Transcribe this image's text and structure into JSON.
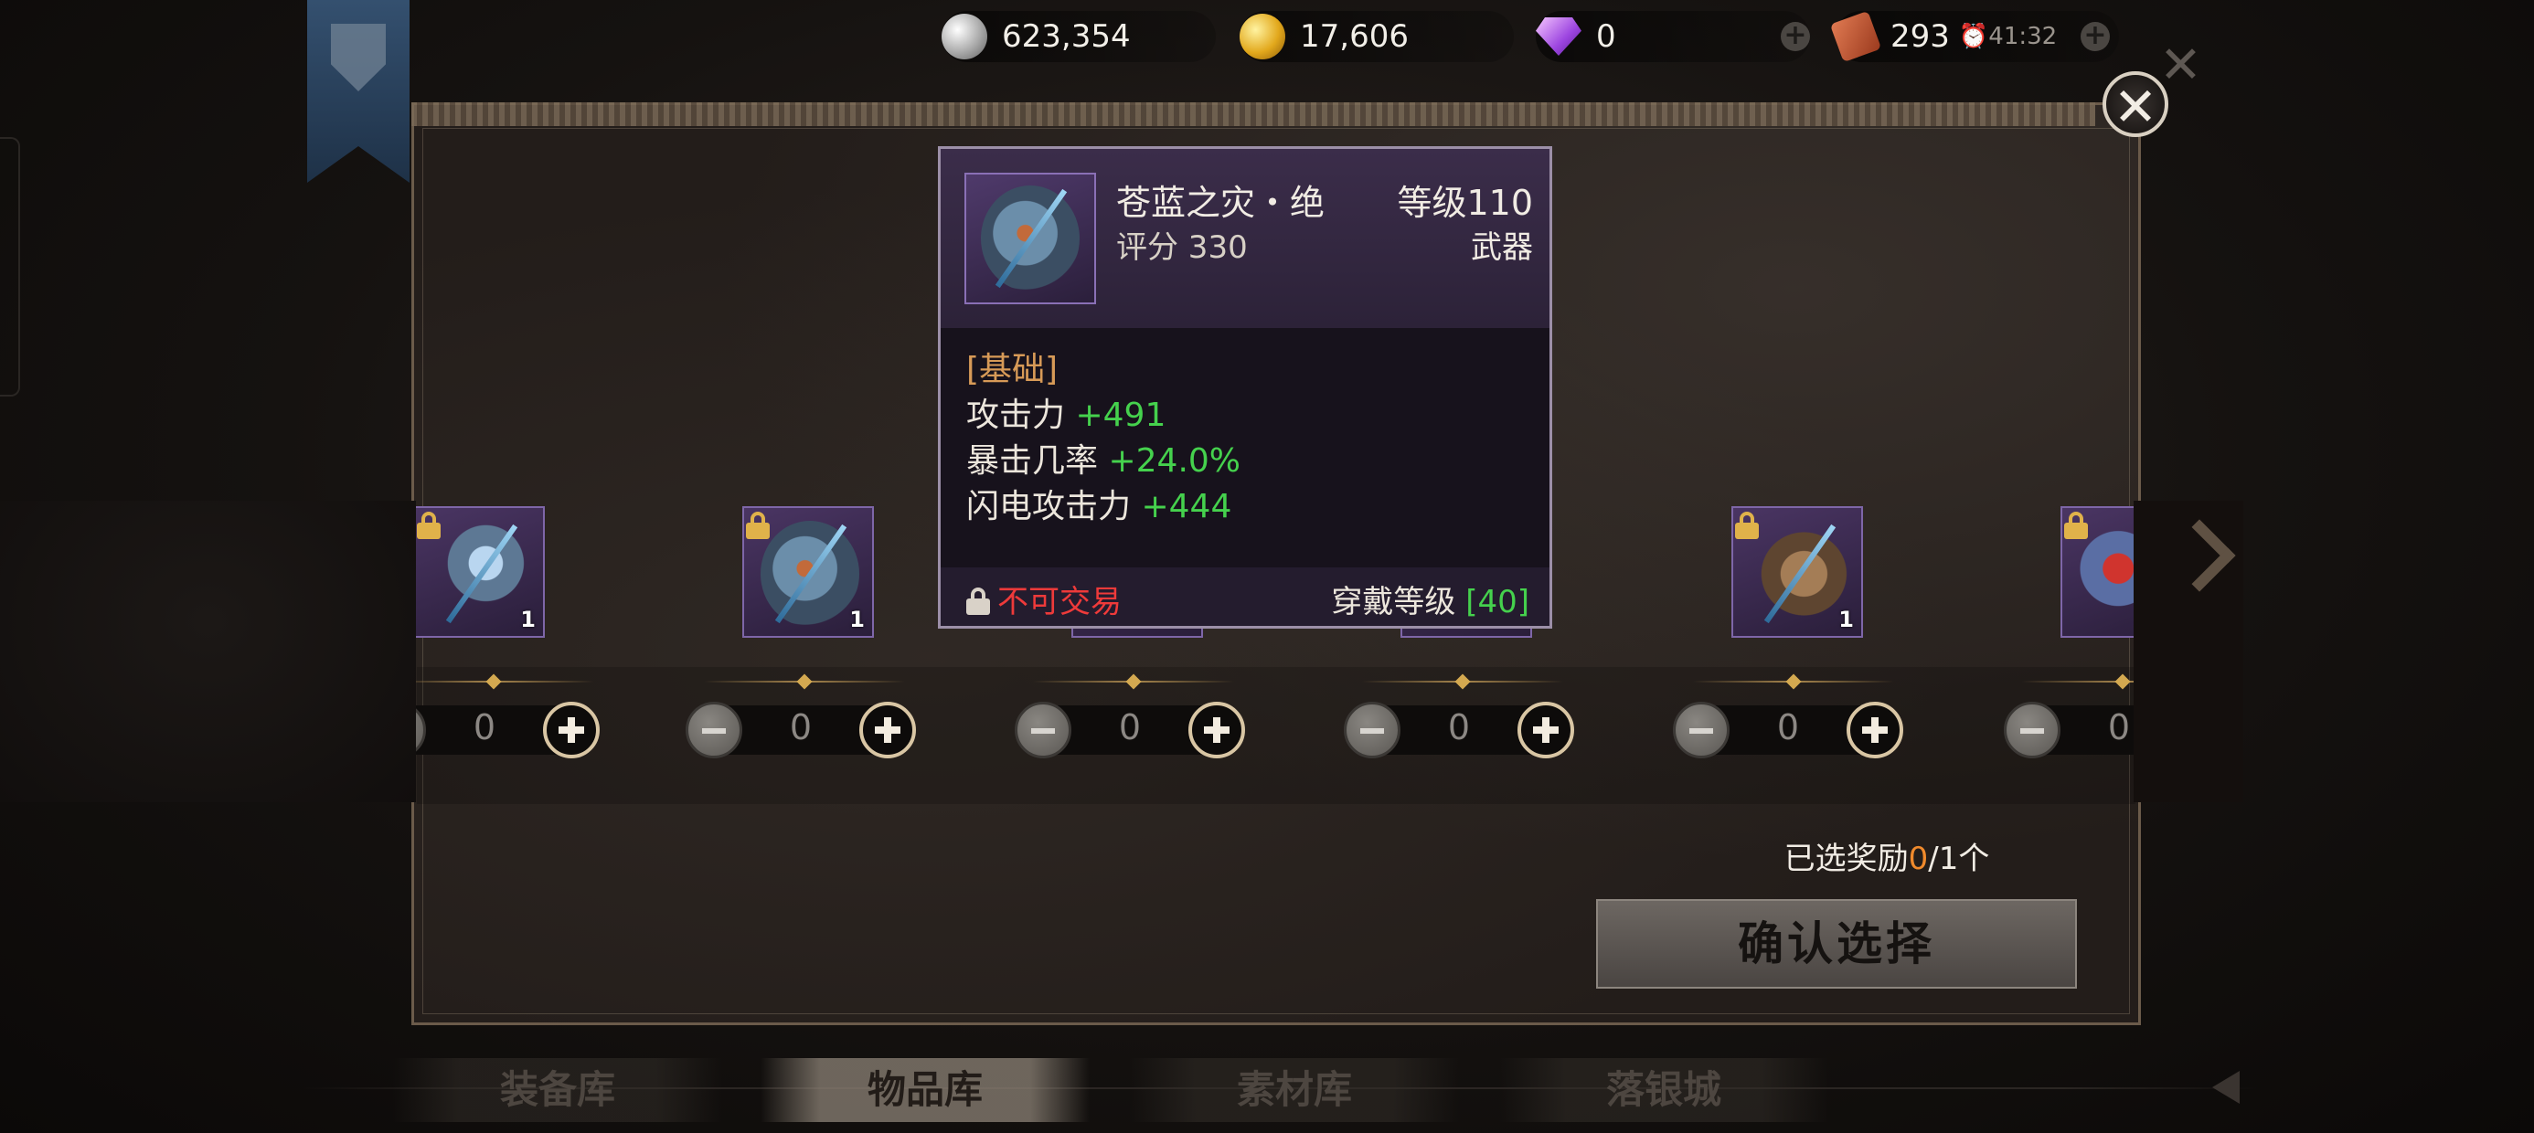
{
  "resources": {
    "silver": {
      "value": "623,354",
      "icon": "silver-coin-icon"
    },
    "gold": {
      "value": "17,606",
      "icon": "gold-coin-icon"
    },
    "gems": {
      "value": "0",
      "icon": "gem-icon"
    },
    "tickets": {
      "value": "293",
      "timer": "41:32",
      "icon": "ticket-icon"
    }
  },
  "tooltip": {
    "name": "苍蓝之灾・绝",
    "level": "等级110",
    "score": "评分 330",
    "type": "武器",
    "section": "[基础]",
    "stats": [
      {
        "label": "攻击力",
        "value": "+491"
      },
      {
        "label": "暴击几率",
        "value": "+24.0%"
      },
      {
        "label": "闪电攻击力",
        "value": "+444"
      }
    ],
    "trade": "不可交易",
    "wear_label": "穿戴等级",
    "wear_value": "[40]"
  },
  "items": [
    {
      "qty": "1",
      "count": "0",
      "locked": true
    },
    {
      "qty": "1",
      "count": "0",
      "locked": true
    },
    {
      "qty": "",
      "count": "0",
      "locked": true
    },
    {
      "qty": "",
      "count": "0",
      "locked": true
    },
    {
      "qty": "1",
      "count": "0",
      "locked": true
    },
    {
      "qty": "",
      "count": "0",
      "locked": true
    }
  ],
  "selection": {
    "prefix": "已选奖励",
    "current": "0",
    "suffix": "/1个"
  },
  "confirm_label": "确认选择",
  "tabs": [
    {
      "label": "装备库",
      "active": false
    },
    {
      "label": "物品库",
      "active": true
    },
    {
      "label": "素材库",
      "active": false
    },
    {
      "label": "落银城",
      "active": false
    }
  ],
  "colors": {
    "stat_green": "#45d14d",
    "warning_red": "#ee3a3a",
    "accent_orange": "#f08a2c"
  }
}
